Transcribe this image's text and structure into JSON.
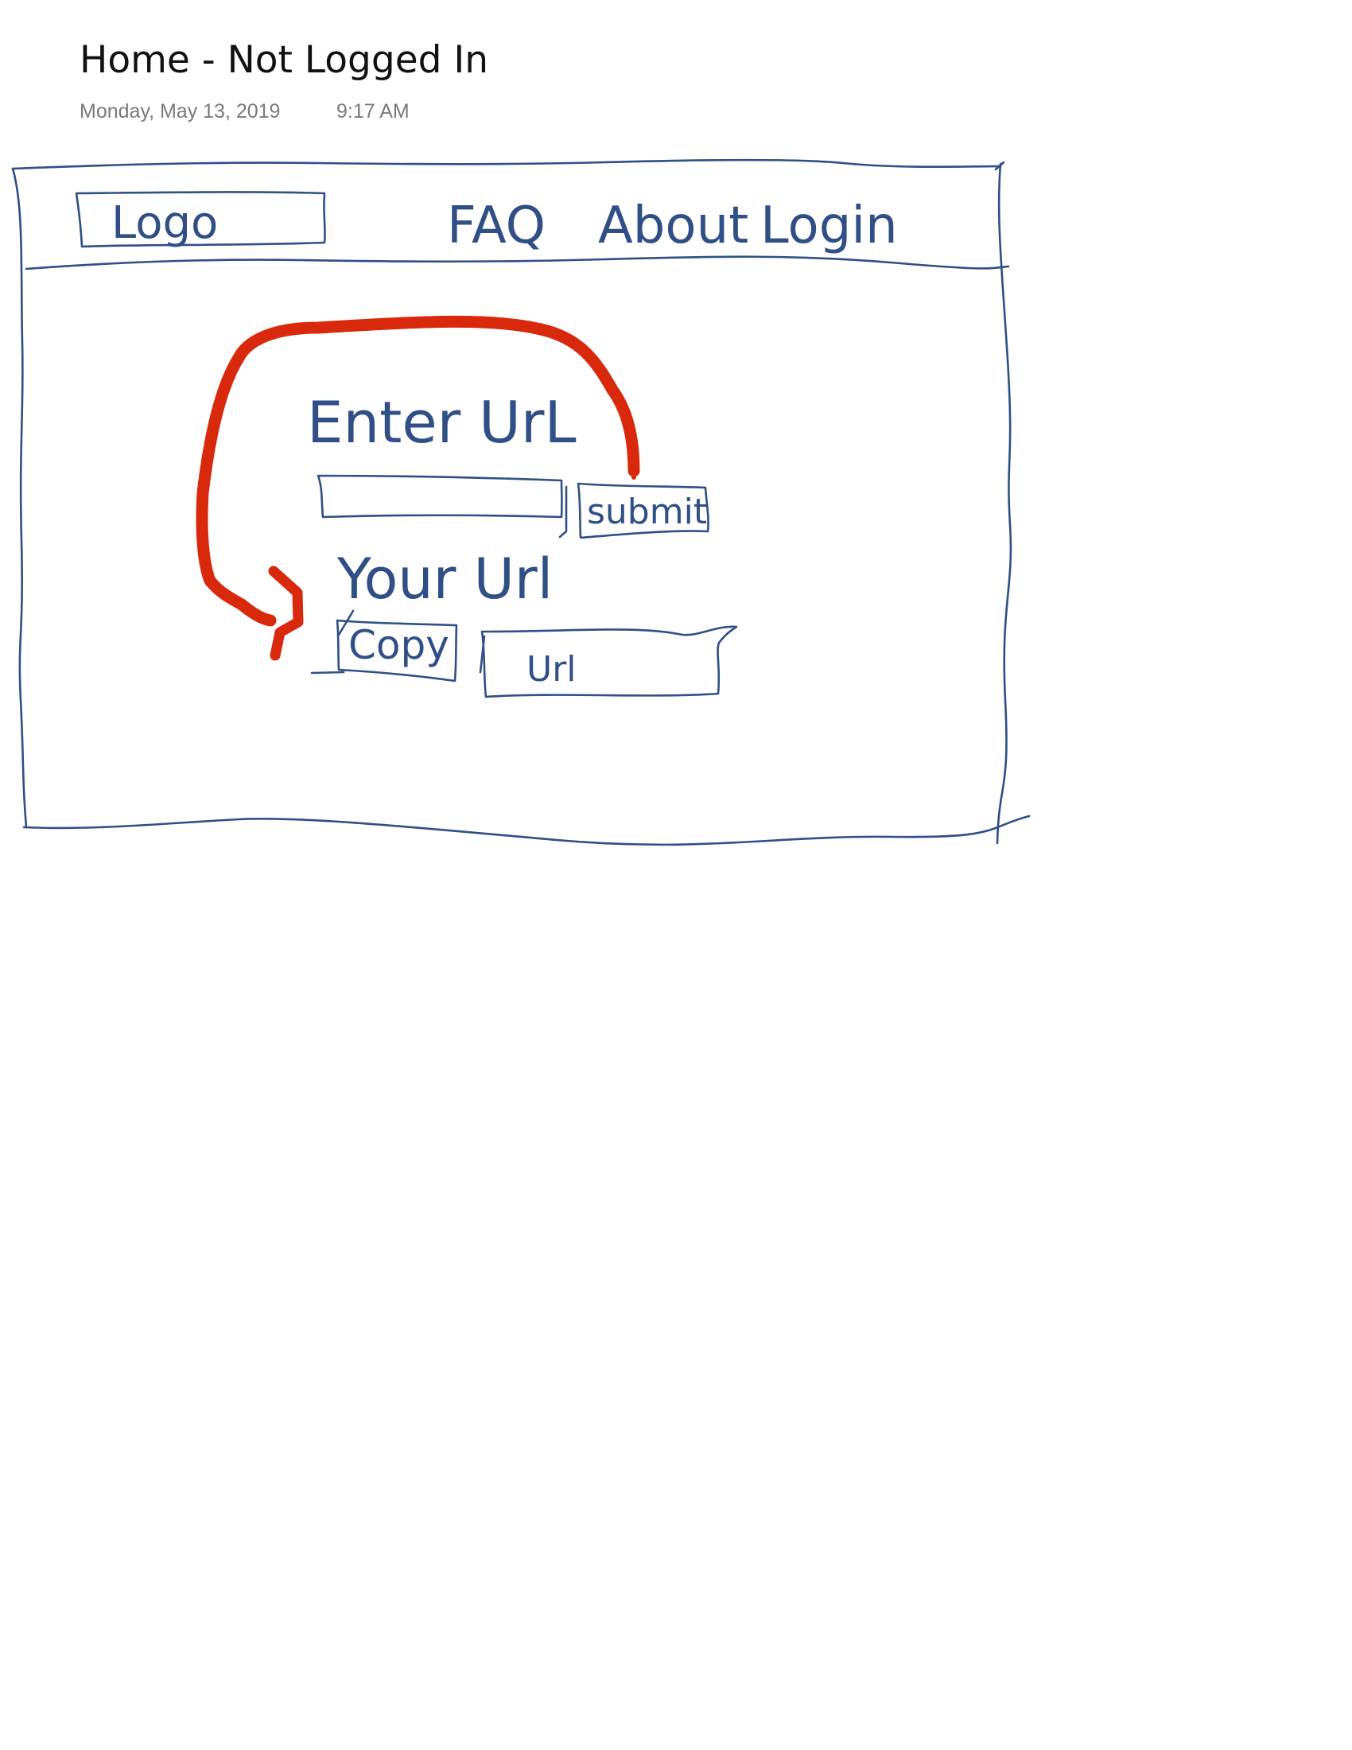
{
  "note": {
    "title": "Home - Not Logged In",
    "date": "Monday, May 13, 2019",
    "time": "9:17 AM"
  },
  "wireframe": {
    "header": {
      "logo_label": "Logo",
      "nav": [
        "FAQ",
        "About",
        "Login"
      ]
    },
    "form": {
      "enter_url_label": "Enter UrL",
      "submit_label": "submit"
    },
    "result": {
      "your_url_label": "Your Url",
      "copy_label": "Copy",
      "url_label": "Url"
    },
    "colors": {
      "ink": "#2f4f86",
      "flow_arrow": "#d9290c"
    }
  }
}
